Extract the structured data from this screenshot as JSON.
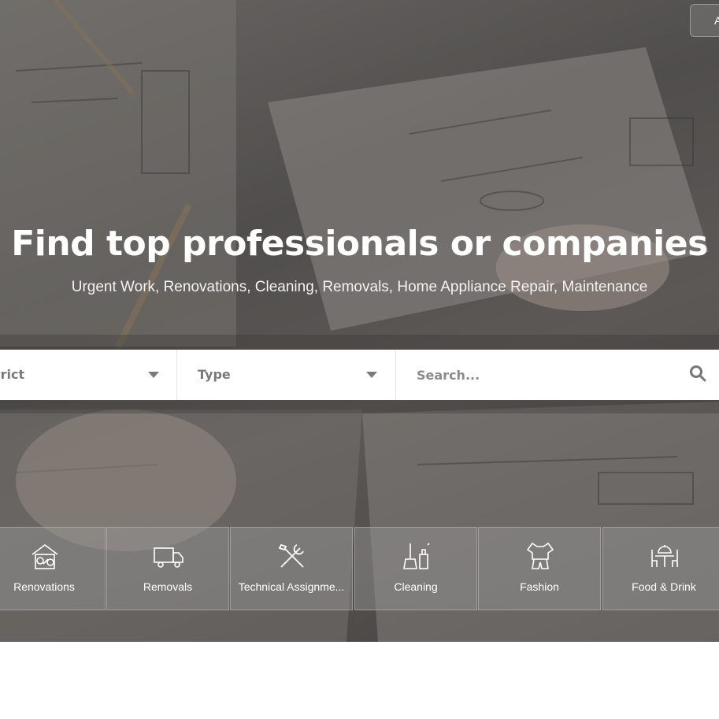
{
  "header": {
    "top_button_label": "A"
  },
  "hero": {
    "title": "Find top professionals or companies",
    "subtitle": "Urgent Work, Renovations, Cleaning, Removals, Home Appliance Repair, Maintenance"
  },
  "search": {
    "district_label": "trict",
    "type_label": "Type",
    "placeholder": "Search...",
    "icon": "search-icon"
  },
  "categories": [
    {
      "label": "Renovations",
      "icon": "renovations-icon"
    },
    {
      "label": "Removals",
      "icon": "truck-icon"
    },
    {
      "label": "Technical Assignme...",
      "icon": "tools-icon"
    },
    {
      "label": "Cleaning",
      "icon": "cleaning-icon"
    },
    {
      "label": "Fashion",
      "icon": "fashion-icon"
    },
    {
      "label": "Food & Drink",
      "icon": "food-drink-icon"
    }
  ],
  "colors": {
    "text_light": "#ffffff",
    "field_text": "#7a7a7a",
    "search_bar_bg": "#ffffff"
  }
}
